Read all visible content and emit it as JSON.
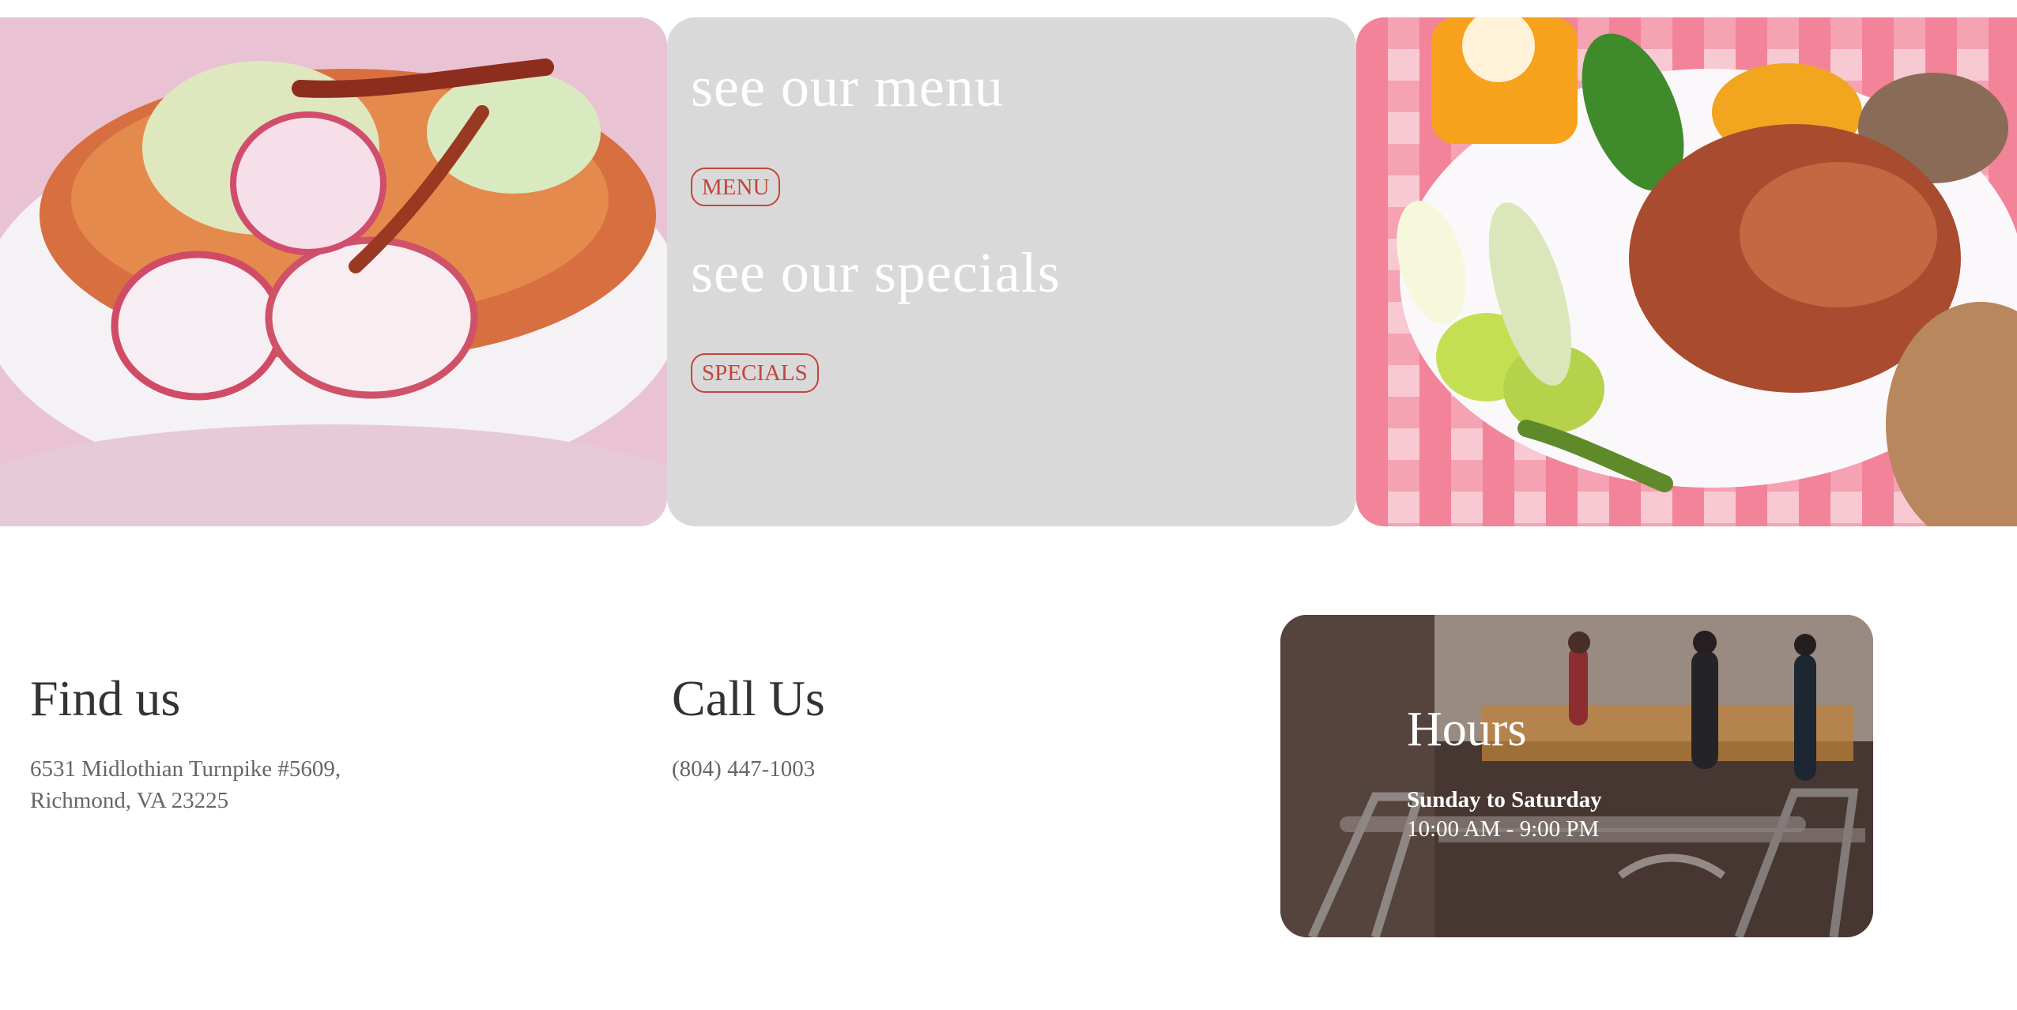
{
  "hero": {
    "menu_heading": "see our menu",
    "menu_button": "MENU",
    "specials_heading": "see our specials",
    "specials_button": "SPECIALS",
    "left_image": "soup-photo",
    "right_image": "platter-photo"
  },
  "find_us": {
    "title": "Find us",
    "address_line_1": "6531 Midlothian Turnpike #5609,",
    "address_line_2": "Richmond, VA 23225"
  },
  "call_us": {
    "title": "Call Us",
    "phone": "(804) 447-1003"
  },
  "hours": {
    "title": "Hours",
    "days": "Sunday to Saturday",
    "time": "10:00 AM - 9:00 PM"
  },
  "colors": {
    "accent_red": "#c5443b",
    "panel_gray": "#d9d9d9",
    "text_dark": "#333333",
    "text_muted": "#666666"
  }
}
